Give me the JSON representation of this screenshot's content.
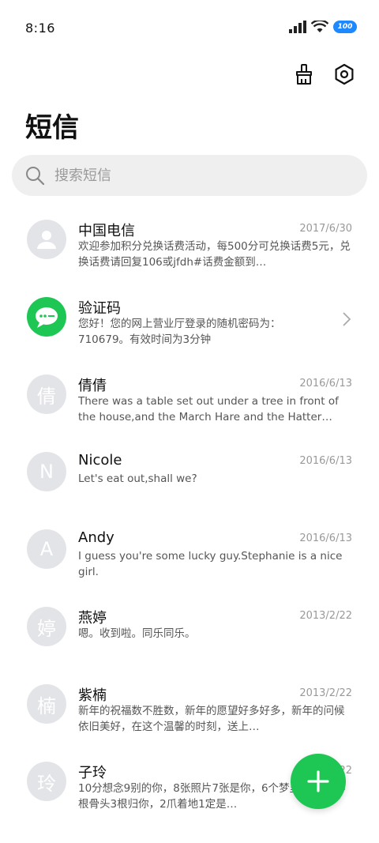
{
  "status_bar": {
    "time": "8:16",
    "battery": "100"
  },
  "header": {
    "title": "短信"
  },
  "search": {
    "placeholder": "搜索短信"
  },
  "messages": [
    {
      "avatar": "",
      "name": "中国电信",
      "date": "2017/6/30",
      "snippet": "欢迎参加积分兑换话费活动，每500分可兑换话费5元，兑换话费请回复106或jfdh#话费金额到…"
    },
    {
      "avatar": "",
      "name": "验证码",
      "date": "",
      "snippet": "您好！您的网上营业厅登录的随机密码为：710679。有效时间为3分钟"
    },
    {
      "avatar": "倩",
      "name": "倩倩",
      "date": "2016/6/13",
      "snippet": "There was a table set out under a tree in front of the house,and the March Hare and the Hatter wer…"
    },
    {
      "avatar": "N",
      "name": "Nicole",
      "date": "2016/6/13",
      "snippet": "Let's eat out,shall we?"
    },
    {
      "avatar": "A",
      "name": "Andy",
      "date": "2016/6/13",
      "snippet": "I guess you're some lucky guy.Stephanie is a nice girl."
    },
    {
      "avatar": "婷",
      "name": "燕婷",
      "date": "2013/2/22",
      "snippet": "嗯。收到啦。同乐同乐。"
    },
    {
      "avatar": "楠",
      "name": "紫楠",
      "date": "2013/2/22",
      "snippet": "新年的祝福数不胜数，新年的愿望好多好多，新年的问候依旧美好，在这个温馨的时刻，送上…"
    },
    {
      "avatar": "玲",
      "name": "子玲",
      "date": "2013/2/22",
      "snippet": "10分想念9别的你，8张照片7张是你，6个梦里5像你，4根骨头3根归你，2爪着地1定是…"
    }
  ],
  "colors": {
    "accent": "#1ec653",
    "avatar_gray": "#e3e4e7",
    "battery": "#1e88ff"
  },
  "icons": {
    "clean": "broom-icon",
    "settings": "settings-hexagon-icon",
    "search": "search-icon",
    "compose": "plus-icon"
  }
}
